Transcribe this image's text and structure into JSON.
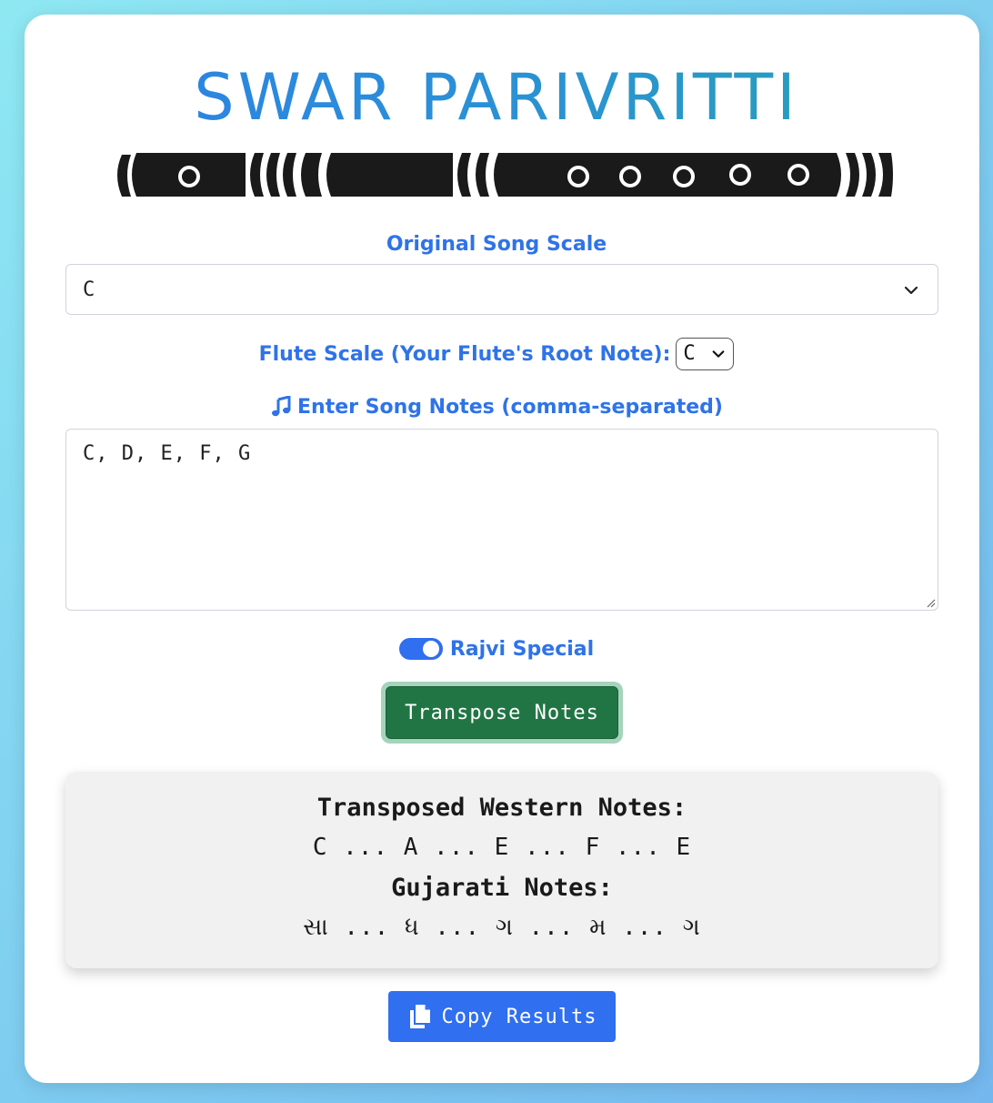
{
  "title": "SWAR PARIVRITTI",
  "original_scale": {
    "label": "Original Song Scale",
    "value": "C"
  },
  "flute_scale": {
    "label": "Flute Scale (Your Flute's Root Note):",
    "value": "C"
  },
  "notes_input": {
    "label": "Enter Song Notes (comma-separated)",
    "value": "C, D, E, F, G",
    "icon": "music-note-icon"
  },
  "toggle": {
    "label": "Rajvi Special",
    "checked": true
  },
  "transpose_button": {
    "label": "Transpose Notes"
  },
  "results": {
    "western_heading": "Transposed Western Notes:",
    "western_notes": "C ... A ... E ... F ... E",
    "gujarati_heading": "Gujarati Notes:",
    "gujarati_notes": "સા ... ધ ... ગ ... મ ... ગ"
  },
  "copy_button": {
    "label": "Copy Results",
    "icon": "copy-icon"
  },
  "colors": {
    "accent_blue": "#2f73e8",
    "success_green": "#217544",
    "copy_blue": "#2f6ff0"
  }
}
